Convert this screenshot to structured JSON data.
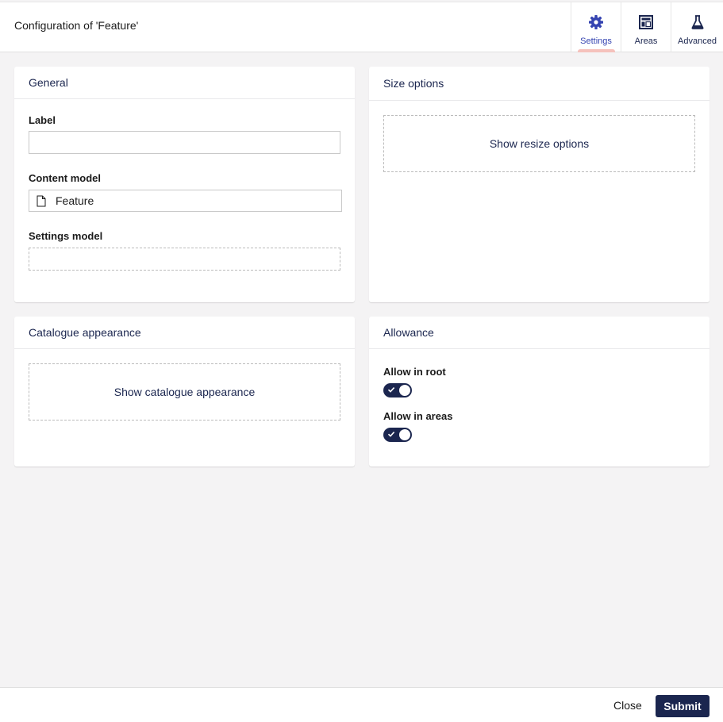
{
  "header": {
    "title": "Configuration of 'Feature'"
  },
  "tabs": [
    {
      "label": "Settings",
      "icon": "gear-icon",
      "active": true
    },
    {
      "label": "Areas",
      "icon": "layout-icon",
      "active": false
    },
    {
      "label": "Advanced",
      "icon": "flask-icon",
      "active": false
    }
  ],
  "general": {
    "title": "General",
    "label_field": {
      "label": "Label",
      "value": ""
    },
    "content_model": {
      "label": "Content model",
      "value": "Feature",
      "icon": "document-icon"
    },
    "settings_model": {
      "label": "Settings model",
      "value": ""
    }
  },
  "size_options": {
    "title": "Size options",
    "button": "Show resize options"
  },
  "catalogue": {
    "title": "Catalogue appearance",
    "button": "Show catalogue appearance"
  },
  "allowance": {
    "title": "Allowance",
    "allow_root": {
      "label": "Allow in root",
      "on": true
    },
    "allow_areas": {
      "label": "Allow in areas",
      "on": true
    }
  },
  "footer": {
    "close_label": "Close",
    "submit_label": "Submit"
  },
  "colors": {
    "primary": "#1b264f",
    "accent": "#3544b1",
    "tab_indicator": "#f5c1bc",
    "background": "#f4f3f4"
  }
}
